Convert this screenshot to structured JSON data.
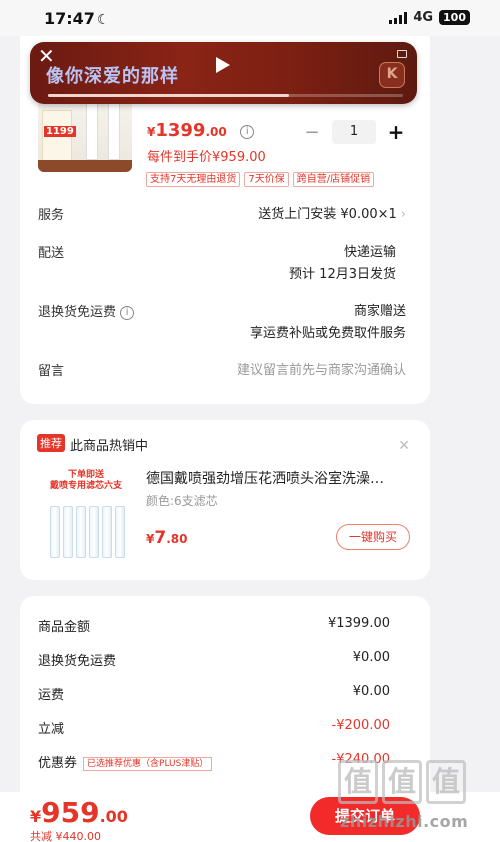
{
  "status_bar": {
    "time": "17:47",
    "network": "4G",
    "battery": "100"
  },
  "music_bar": {
    "title": "像你深爱的那样",
    "logo": "K",
    "progress": 0.68
  },
  "product": {
    "currency": "¥",
    "price_int": "1399",
    "price_dec": ".00",
    "quantity": "1",
    "final_price": "每件到手价¥959.00",
    "tags": [
      "支持7天无理由退货",
      "7天价保",
      "跨自营/店铺促销"
    ],
    "image_tag": "1199"
  },
  "rows": {
    "service": {
      "label": "服务",
      "value": "送货上门安装  ¥0.00×1"
    },
    "delivery": {
      "label": "配送",
      "value1": "快递运输",
      "value2": "预计 12月3日发货"
    },
    "return_fee": {
      "label": "退换货免运费",
      "value1": "商家赠送",
      "value2": "享运费补贴或免费取件服务"
    },
    "message": {
      "label": "留言",
      "placeholder": "建议留言前先与商家沟通确认"
    }
  },
  "recommend": {
    "badge": "推荐",
    "title": "此商品热销中",
    "image_caption1": "下单即送",
    "image_caption2": "戴喷专用滤芯六支",
    "name": "德国戴喷强劲增压花洒喷头浴室洗澡…",
    "spec": "颜色:6支滤芯",
    "currency": "¥",
    "price_int": "7",
    "price_dec": ".80",
    "button": "一键购买"
  },
  "totals": {
    "goods_amount": {
      "label": "商品金额",
      "value": "¥1399.00"
    },
    "return_fee": {
      "label": "退换货免运费",
      "value": "¥0.00"
    },
    "shipping": {
      "label": "运费",
      "value": "¥0.00"
    },
    "discount": {
      "label": "立减",
      "value": "-¥200.00"
    },
    "coupon": {
      "label": "优惠券",
      "tag": "已选推荐优惠（含PLUS津贴）",
      "value": "-¥240.00"
    }
  },
  "bottom": {
    "currency": "¥",
    "amount_int": "959",
    "amount_dec": ".00",
    "saved": "共减 ¥440.00",
    "submit": "提交订单"
  },
  "watermark": {
    "logo": "值",
    "text": "zhizhizhi.com"
  },
  "colors": {
    "accent_red": "#e53528",
    "music_bg": "#7a1f12",
    "submit_bg": "#f22a2a"
  }
}
